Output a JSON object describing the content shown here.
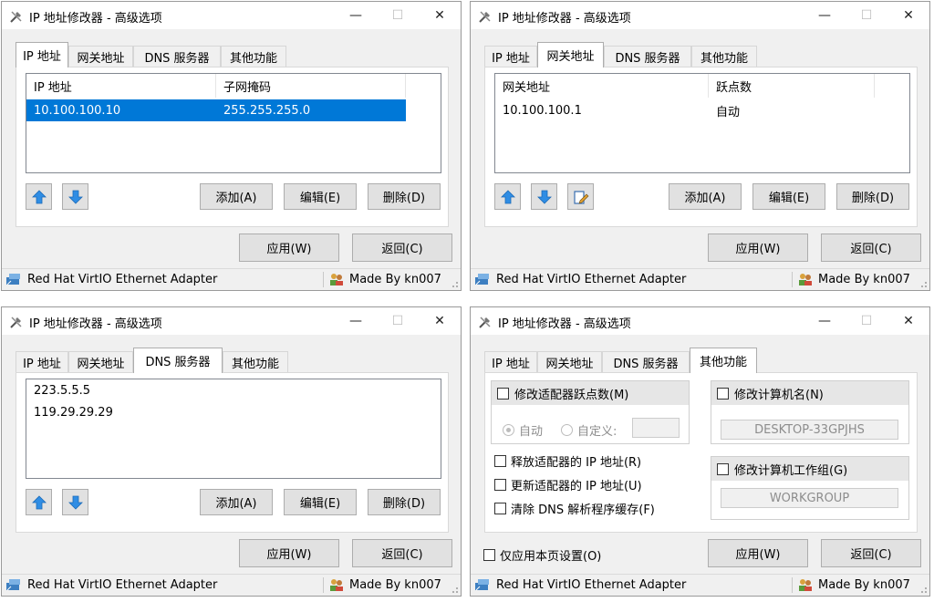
{
  "window": {
    "title": "IP 地址修改器 - 高级选项",
    "minimize": "—",
    "maximize": "☐",
    "close": "✕"
  },
  "tabs": [
    "IP 地址",
    "网关地址",
    "DNS 服务器",
    "其他功能"
  ],
  "ip_tab": {
    "columns": [
      "IP 地址",
      "子网掩码"
    ],
    "rows": [
      {
        "ip": "10.100.100.10",
        "mask": "255.255.255.0"
      }
    ]
  },
  "gateway_tab": {
    "columns": [
      "网关地址",
      "跃点数"
    ],
    "rows": [
      {
        "gateway": "10.100.100.1",
        "metric": "自动"
      }
    ]
  },
  "dns_tab": {
    "servers": [
      "223.5.5.5",
      "119.29.29.29"
    ]
  },
  "other_tab": {
    "metric_group": "修改适配器跃点数(M)",
    "auto_label": "自动",
    "custom_label": "自定义:",
    "custom_value": "",
    "release_ip": "释放适配器的 IP 地址(R)",
    "renew_ip": "更新适配器的 IP 地址(U)",
    "flush_dns": "清除 DNS 解析程序缓存(F)",
    "computer_name_group": "修改计算机名(N)",
    "computer_name": "DESKTOP-33GPJHS",
    "workgroup_group": "修改计算机工作组(G)",
    "workgroup": "WORKGROUP",
    "apply_page_only": "仅应用本页设置(O)"
  },
  "buttons": {
    "add": "添加(A)",
    "edit": "编辑(E)",
    "delete": "删除(D)",
    "apply": "应用(W)",
    "back": "返回(C)"
  },
  "status": {
    "adapter": "Red Hat VirtIO Ethernet Adapter",
    "author": "Made By kn007"
  },
  "colors": {
    "selection": "#0078d7",
    "window_bg": "#f0f0f0",
    "arrow_blue": "#2f8de4"
  }
}
